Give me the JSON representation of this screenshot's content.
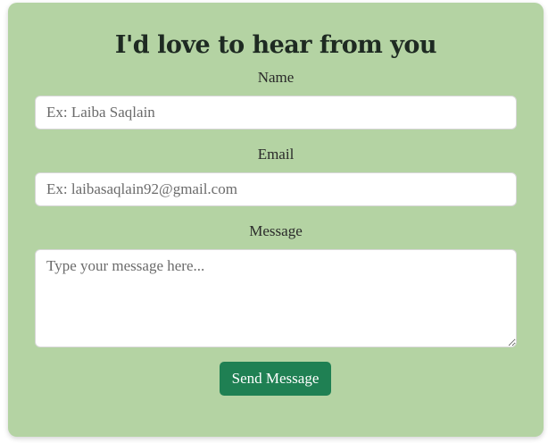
{
  "form": {
    "title": "I'd love to hear from you",
    "name_label": "Name",
    "name_placeholder": "Ex: Laiba Saqlain",
    "email_label": "Email",
    "email_placeholder": "Ex: laibasaqlain92@gmail.com",
    "message_label": "Message",
    "message_placeholder": "Type your message here...",
    "submit_label": "Send Message"
  },
  "colors": {
    "card_background": "#b4d3a3",
    "button_background": "#1f8053",
    "title_text": "#1e2a22"
  }
}
